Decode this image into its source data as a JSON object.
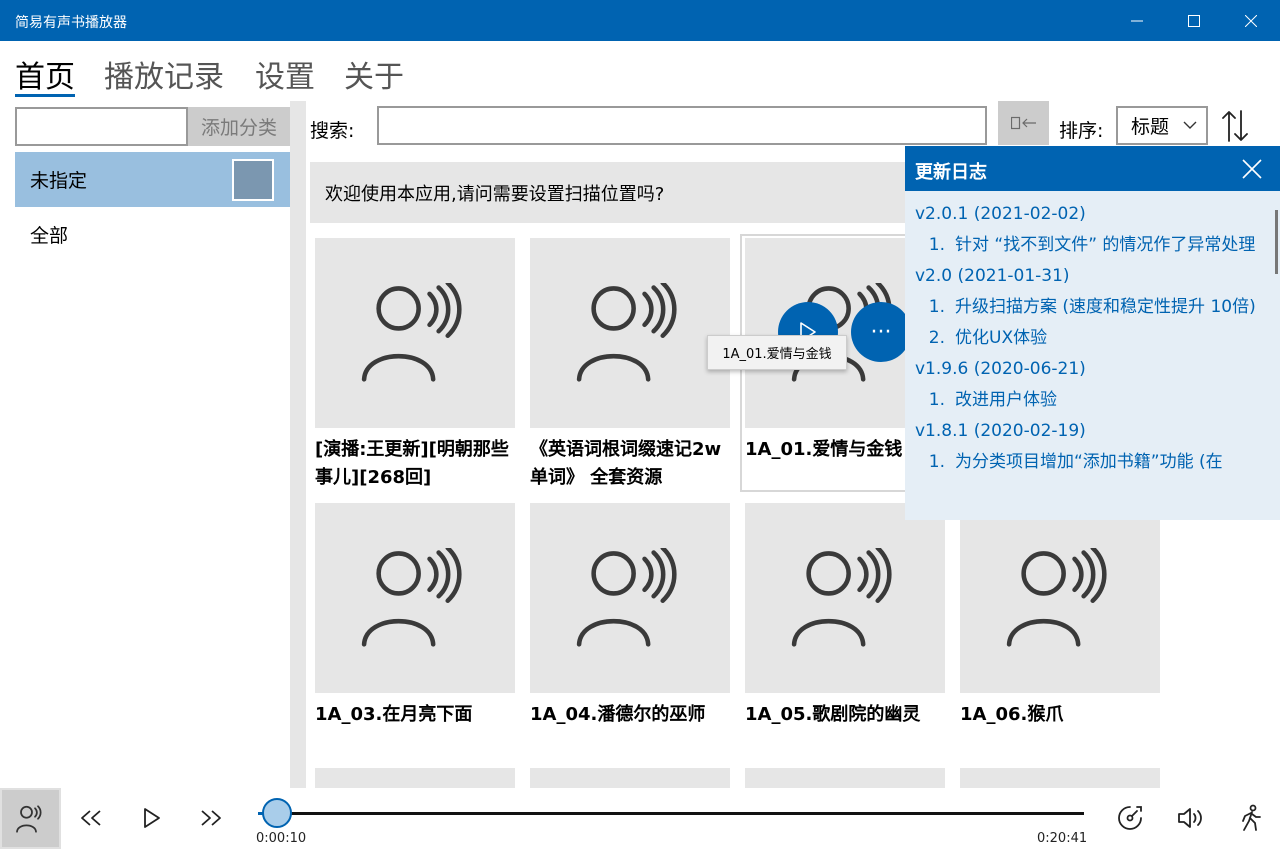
{
  "window": {
    "title": "简易有声书播放器"
  },
  "tabs": [
    {
      "label": "首页"
    },
    {
      "label": "播放记录"
    },
    {
      "label": "设置"
    },
    {
      "label": "关于"
    }
  ],
  "sidebar": {
    "category_input_value": "",
    "add_category_label": "添加分类",
    "items": [
      {
        "label": "未指定"
      },
      {
        "label": "全部"
      }
    ]
  },
  "search": {
    "label": "搜索:",
    "value": ""
  },
  "sort": {
    "label": "排序:",
    "value": "标题"
  },
  "banner": {
    "text": "欢迎使用本应用,请问需要设置扫描位置吗?"
  },
  "books": [
    {
      "title": "[演播:王更新][明朝那些事儿][268回]"
    },
    {
      "title": "《英语词根词缀速记2w 单词》 全套资源"
    },
    {
      "title": "1A_01.爱情与金钱"
    },
    {
      "title": "1A_03.在月亮下面"
    },
    {
      "title": "1A_04.潘德尔的巫师"
    },
    {
      "title": "1A_05.歌剧院的幽灵"
    },
    {
      "title": "1A_06.猴爪"
    }
  ],
  "tooltip": {
    "text": "1A_01.爱情与金钱"
  },
  "overlay": {
    "more_label": "···"
  },
  "changelog": {
    "title": "更新日志",
    "versions": [
      {
        "version": "v2.0.1 (2021-02-02)",
        "entries": [
          {
            "num": "1.",
            "text": "针对 “找不到文件” 的情况作了异常处理"
          }
        ]
      },
      {
        "version": "v2.0 (2021-01-31)",
        "entries": [
          {
            "num": "1.",
            "text": "升级扫描方案 (速度和稳定性提升 10倍)"
          },
          {
            "num": "2.",
            "text": "优化UX体验"
          }
        ]
      },
      {
        "version": "v1.9.6 (2020-06-21)",
        "entries": [
          {
            "num": "1.",
            "text": "改进用户体验"
          }
        ]
      },
      {
        "version": "v1.8.1 (2020-02-19)",
        "entries": [
          {
            "num": "1.",
            "text": "为分类项目增加“添加书籍”功能 (在"
          }
        ]
      }
    ]
  },
  "player": {
    "current_time": "0:00:10",
    "total_time": "0:20:41",
    "progress": 0.008
  },
  "icons": {
    "library": "audiobook-icon",
    "rewind": "rewind-icon",
    "play": "play-icon",
    "fast_forward": "fast-forward-icon",
    "speed": "playback-speed-icon",
    "volume": "volume-icon",
    "walk": "walking-icon",
    "sort_toggle": "sort-direction-icon"
  },
  "colors": {
    "accent": "#0063b1",
    "selected": "#99bfdf",
    "tile": "#e6e6e6"
  }
}
